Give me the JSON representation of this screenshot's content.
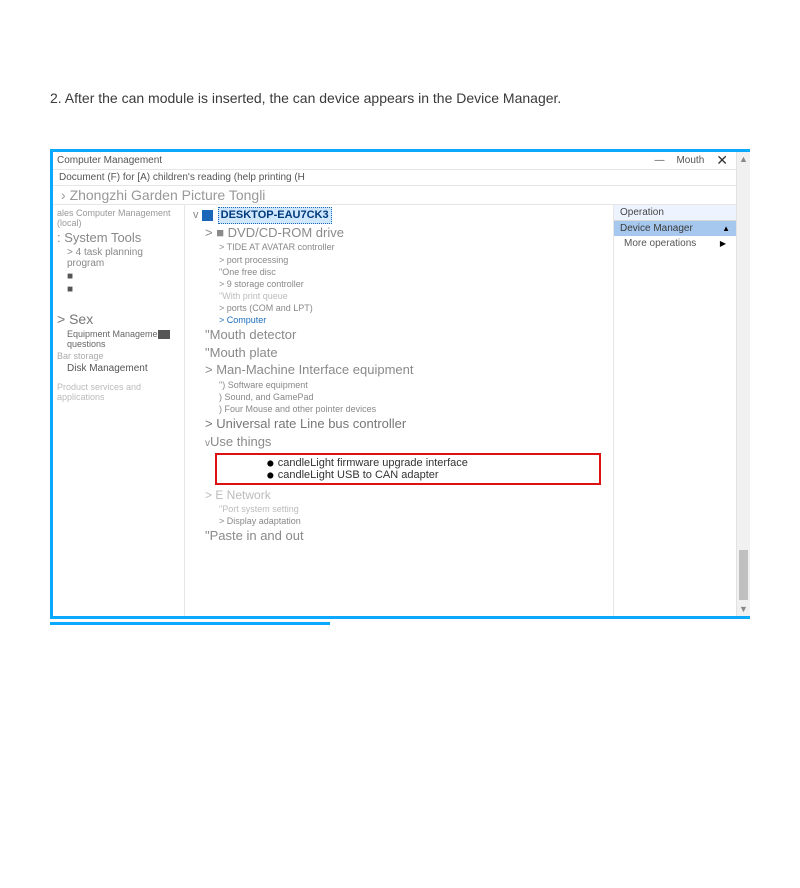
{
  "instruction": "2. After the can module is inserted, the can device appears in the Device Manager.",
  "window": {
    "title": "Computer Management",
    "mouth": "Mouth",
    "menubar": "Document (F) for  [A) children's reading (help printing (H",
    "breadcrumb": "Zhongzhi Garden Picture Tongli"
  },
  "left": {
    "hdr": "ales Computer Management (local)",
    "system_tools": "System Tools",
    "task_planning": "4 task planning program",
    "bullet_a": "■",
    "bullet_b": "■",
    "sex": "> Sex",
    "equip": "Equipment Manageme",
    "questions": "questions",
    "bar_storage": "Bar storage",
    "disk_mgmt": "Disk Management",
    "product_srv": "Product services and applications"
  },
  "mid": {
    "root_name": "DESKTOP-EAU7CK3",
    "dvd": "> ■ DVD/CD-ROM drive",
    "tide": "> TIDE AT AVATAR controller",
    "port": "> port processing",
    "onefree": "\"One free disc",
    "storage": "> 9 storage controller",
    "printq": "\"With print queue",
    "ports": "> ports (COM and LPT)",
    "computer": "> Computer",
    "mouth_det": "\"Mouth detector",
    "mouth_plate": "\"Mouth plate",
    "hmi": "> Man-Machine Interface equipment",
    "sw_eq": "\") Software equipment",
    "sound": ") Sound, and GamePad",
    "mouse": ") Four Mouse and other pointer devices",
    "urlbc": "> Universal rate Line bus controller",
    "use_things": "Use things",
    "candle_fw": "candleLight firmware upgrade interface",
    "candle_usb": "candleLight USB to CAN adapter",
    "network": "> E Network",
    "port_sys": "\"Port system setting",
    "disp_adapt": "> Display adaptation",
    "paste": "\"Paste in and out"
  },
  "right": {
    "operation": "Operation",
    "device_mgr": "Device Manager",
    "more_ops": "More operations"
  }
}
